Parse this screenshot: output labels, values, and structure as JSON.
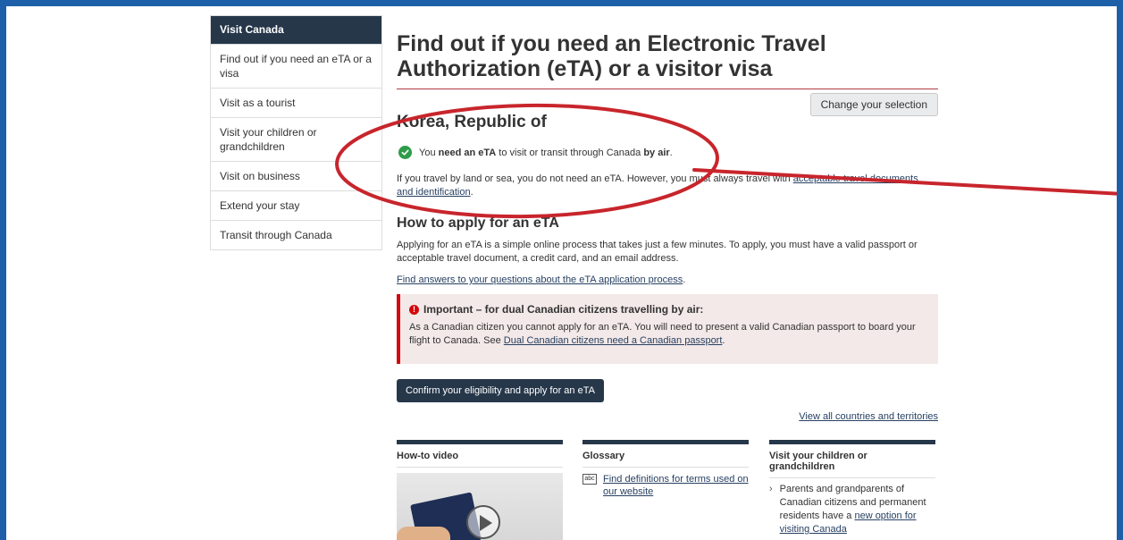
{
  "sidebar": {
    "heading": "Visit Canada",
    "items": [
      {
        "label": "Find out if you need an eTA or a visa"
      },
      {
        "label": "Visit as a tourist"
      },
      {
        "label": "Visit your children or grandchildren"
      },
      {
        "label": "Visit on business"
      },
      {
        "label": "Extend your stay"
      },
      {
        "label": "Transit through Canada"
      }
    ]
  },
  "main": {
    "title": "Find out if you need an Electronic Travel Authorization (eTA) or a visitor visa",
    "change_button": "Change your selection",
    "country": "Korea, Republic of",
    "need": {
      "pre": "You ",
      "bold1": "need an eTA",
      "mid": " to visit or transit through Canada ",
      "bold2": "by air",
      "post": "."
    },
    "land_sea": {
      "text": "If you travel by land or sea, you do not need an eTA. However, you must always travel with ",
      "link": "acceptable travel documents and identification",
      "post": "."
    },
    "apply_heading": "How to apply for an eTA",
    "apply_text": "Applying for an eTA is a simple online process that takes just a few minutes. To apply, you must have a valid passport or acceptable travel document, a credit card, and an email address.",
    "faq_link": "Find answers to your questions about the eTA application process",
    "faq_post": ".",
    "important": {
      "title": "Important – for dual Canadian citizens travelling by air:",
      "text": "As a Canadian citizen you cannot apply for an eTA. You will need to present a valid Canadian passport to board your flight to Canada. See ",
      "link": "Dual Canadian citizens need a Canadian passport",
      "post": "."
    },
    "confirm_button": "Confirm your eligibility and apply for an eTA",
    "view_all": "View all countries and territories"
  },
  "columns": {
    "video": {
      "title": "How-to video"
    },
    "glossary": {
      "title": "Glossary",
      "link": "Find definitions for terms used on our website",
      "icon_text": "abc"
    },
    "visit": {
      "title": "Visit your children or grandchildren",
      "text": "Parents and grandparents of Canadian citizens and permanent residents have a ",
      "link": "new option for visiting Canada"
    }
  },
  "colors": {
    "frame": "#1d5fa8",
    "nav_dark": "#26374a",
    "annotation": "#c8252c",
    "success": "#2e9c4a",
    "alert": "#d3080c"
  }
}
